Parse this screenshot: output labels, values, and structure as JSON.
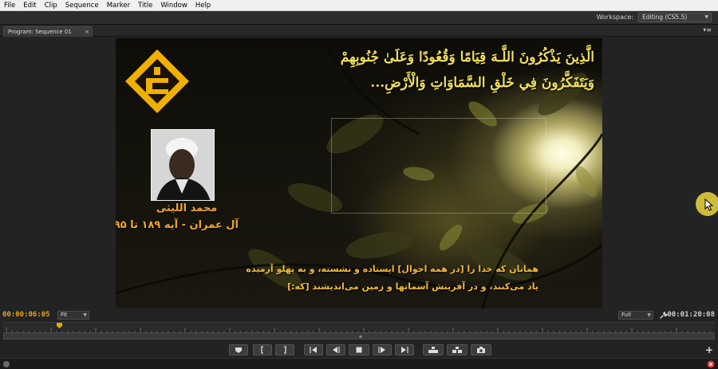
{
  "menu": [
    "File",
    "Edit",
    "Clip",
    "Sequence",
    "Marker",
    "Title",
    "Window",
    "Help"
  ],
  "workspace": {
    "label": "Workspace:",
    "value": "Editing (CS5.5)"
  },
  "panel": {
    "tab_label": "Program: Sequence 01",
    "close_glyph": "×",
    "menu_glyph": "▾≡"
  },
  "video": {
    "verse_line1": "الَّذِينَ يَذْكُرُونَ اللَّـهَ قِيَامًا وَقُعُودًا وَعَلَىٰ جُنُوبِهِمْ",
    "verse_line2": "وَيَتَفَكَّرُونَ فِي خَلْقِ السَّمَاوَاتِ وَالْأَرْضِ...",
    "reciter": "محمد الليثى",
    "surah_range": "آل عمران - آیه ۱۸۹ تا ۱۹۵",
    "translation_line1": "همانان که خدا را [در همه احوال] ایستاده و نشسته، و به پهلو آرمیده",
    "translation_line2": "یاد می‌کنند، و در آفرینش آسمانها و زمین می‌اندیشند [که:]"
  },
  "info": {
    "current_time": "00:00:06:05",
    "zoom": "Fit",
    "resolution": "Full",
    "duration": "00:01:20:08"
  },
  "transport_buttons": [
    {
      "name": "add-marker-button",
      "icon": "marker-icon"
    },
    {
      "name": "mark-in-button",
      "icon": "mark-in-icon"
    },
    {
      "name": "mark-out-button",
      "icon": "mark-out-icon"
    },
    {
      "name": "go-to-in-button",
      "icon": "go-to-in-icon"
    },
    {
      "name": "step-back-button",
      "icon": "step-back-icon"
    },
    {
      "name": "stop-button",
      "icon": "stop-icon"
    },
    {
      "name": "step-forward-button",
      "icon": "step-forward-icon"
    },
    {
      "name": "go-to-out-button",
      "icon": "go-to-out-icon"
    },
    {
      "name": "lift-button",
      "icon": "lift-icon"
    },
    {
      "name": "extract-button",
      "icon": "extract-icon"
    },
    {
      "name": "export-frame-button",
      "icon": "camera-icon"
    }
  ],
  "colors": {
    "accent_timecode": "#e8a317",
    "verse_text": "#f2e05a",
    "caption_text": "#f4b93a"
  }
}
